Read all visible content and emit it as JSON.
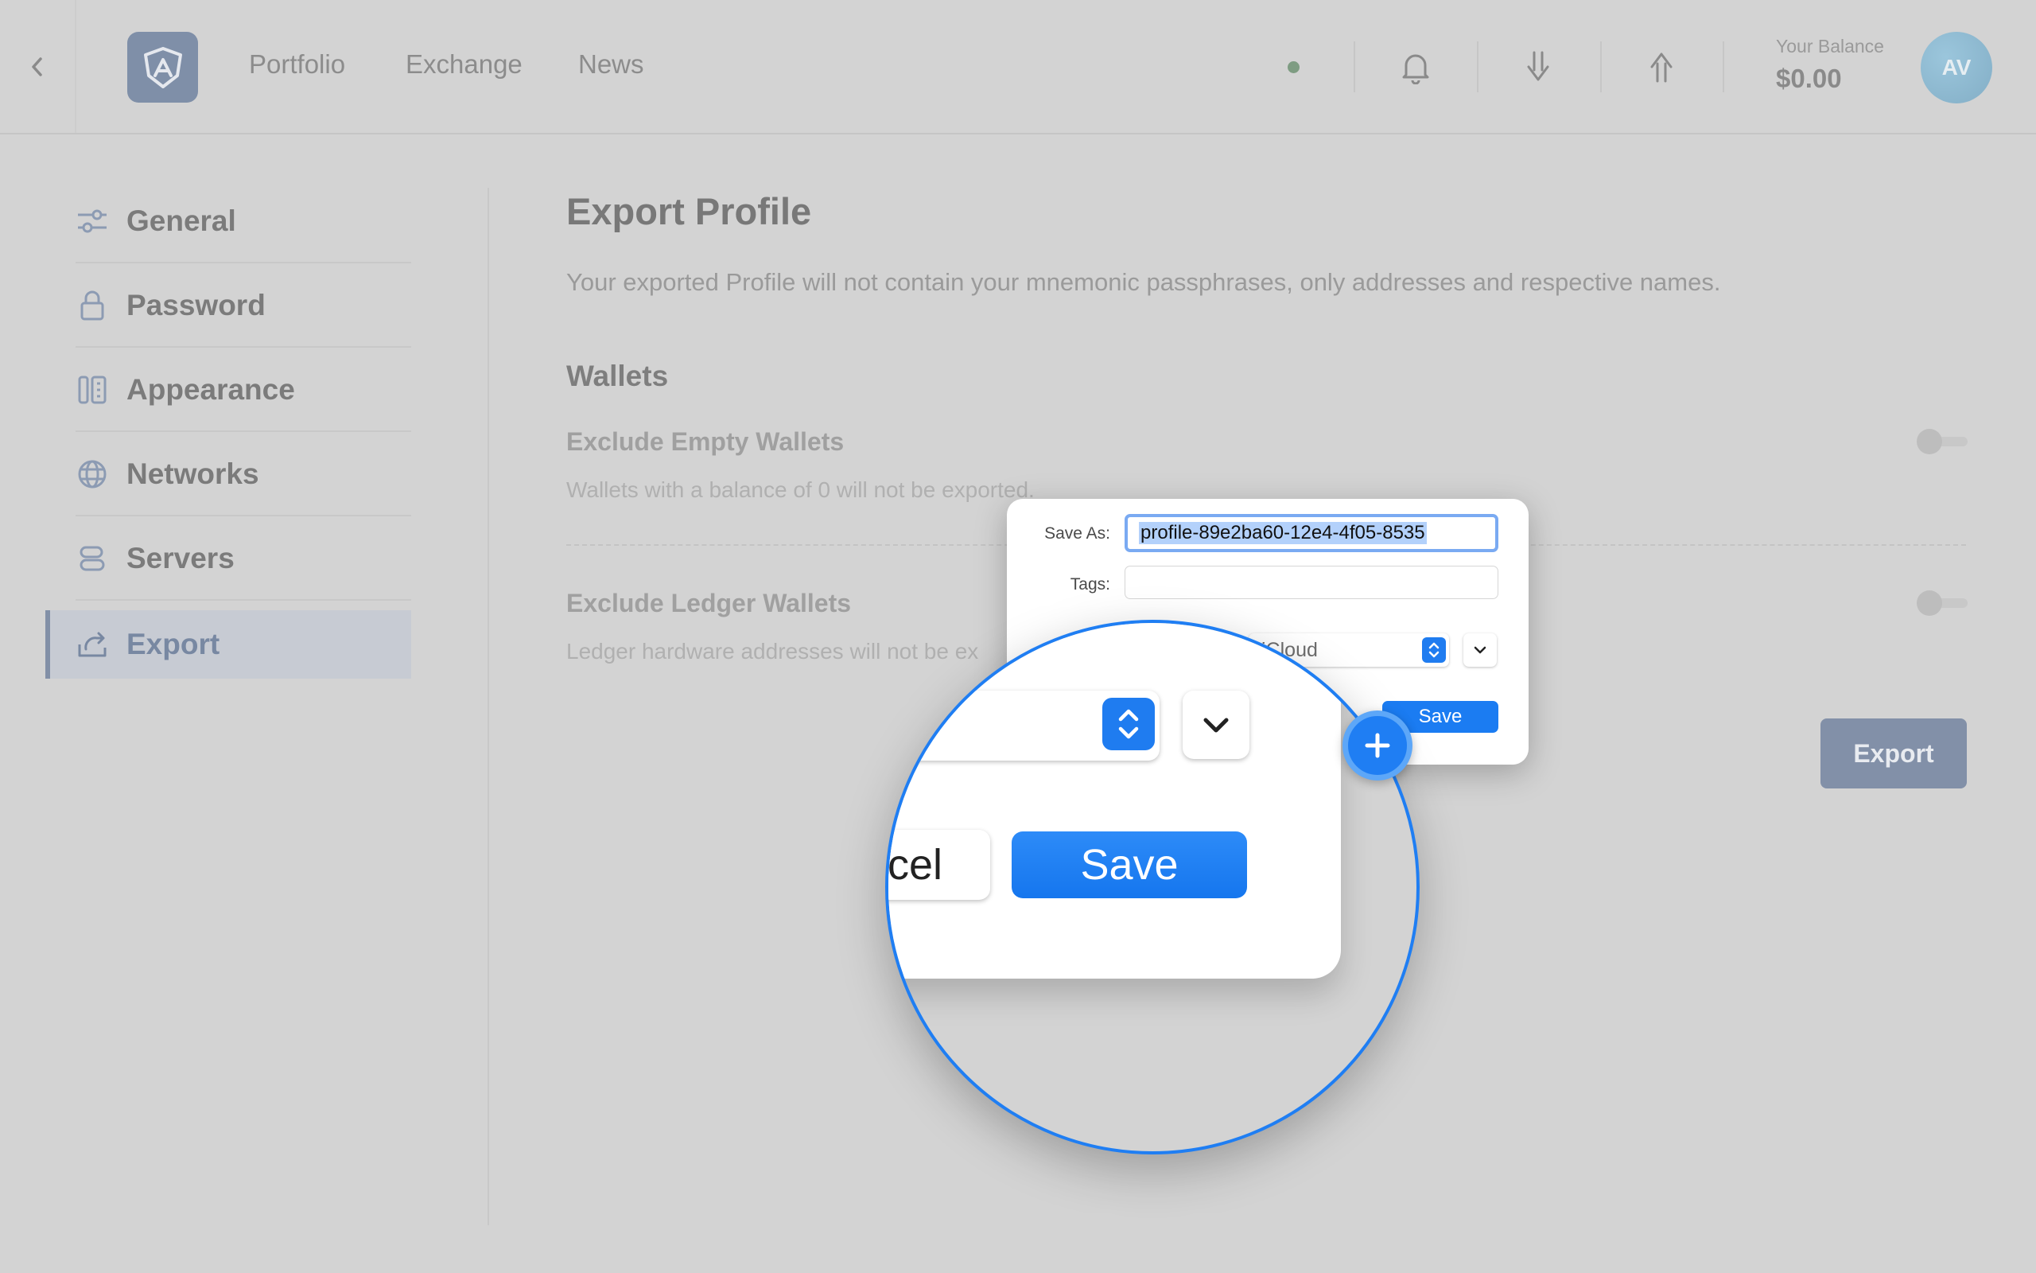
{
  "header": {
    "nav": [
      "Portfolio",
      "Exchange",
      "News"
    ],
    "balance_label": "Your Balance",
    "balance_value": "$0.00",
    "avatar_initials": "AV",
    "status_color": "#7e9c82"
  },
  "sidebar": {
    "items": [
      {
        "label": "General",
        "icon": "sliders-icon"
      },
      {
        "label": "Password",
        "icon": "lock-icon"
      },
      {
        "label": "Appearance",
        "icon": "appearance-icon"
      },
      {
        "label": "Networks",
        "icon": "globe-icon"
      },
      {
        "label": "Servers",
        "icon": "server-icon"
      },
      {
        "label": "Export",
        "icon": "export-icon",
        "active": true
      }
    ]
  },
  "main": {
    "title": "Export Profile",
    "description": "Your exported Profile will not contain your mnemonic passphrases, only addresses and respective names.",
    "section": "Wallets",
    "options": [
      {
        "title": "Exclude Empty Wallets",
        "description": "Wallets with a balance of 0 will not be exported.",
        "enabled": false
      },
      {
        "title": "Exclude Ledger Wallets",
        "description": "Ledger hardware addresses will not be ex",
        "enabled": false
      }
    ],
    "export_button": "Export"
  },
  "dialog": {
    "save_as_label": "Save As:",
    "save_as_value": "profile-89e2ba60-12e4-4f05-8535",
    "tags_label": "Tags:",
    "tags_value": "",
    "where_value": "iCloud",
    "save_button": "Save"
  },
  "magnifier": {
    "cancel_fragment": "cel",
    "save_button": "Save"
  },
  "colors": {
    "accent": "#1f7ef3",
    "brand": "#8290a8"
  }
}
